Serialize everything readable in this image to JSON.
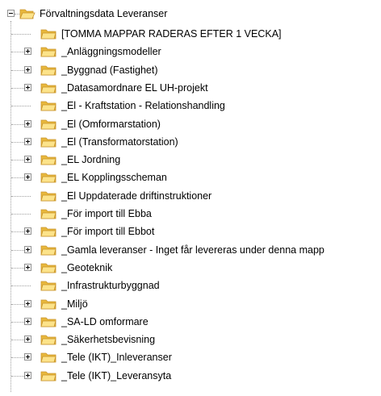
{
  "tree": {
    "root": {
      "label": "Förvaltningsdata Leveranser",
      "icon": "folder-open-icon",
      "expanded": true
    },
    "children": [
      {
        "label": "[TOMMA MAPPAR RADERAS EFTER 1 VECKA]",
        "expandable": false
      },
      {
        "label": "_Anläggningsmodeller",
        "expandable": true
      },
      {
        "label": "_Byggnad (Fastighet)",
        "expandable": true
      },
      {
        "label": "_Datasamordnare EL UH-projekt",
        "expandable": true
      },
      {
        "label": "_El - Kraftstation - Relationshandling",
        "expandable": false
      },
      {
        "label": "_El (Omformarstation)",
        "expandable": true
      },
      {
        "label": "_El (Transformatorstation)",
        "expandable": true
      },
      {
        "label": "_EL Jordning",
        "expandable": true
      },
      {
        "label": "_EL Kopplingsscheman",
        "expandable": true
      },
      {
        "label": "_El Uppdaterade driftinstruktioner",
        "expandable": false
      },
      {
        "label": "_För import till Ebba",
        "expandable": false
      },
      {
        "label": "_För import till Ebbot",
        "expandable": true
      },
      {
        "label": "_Gamla leveranser - Inget får levereras under denna mapp",
        "expandable": true
      },
      {
        "label": "_Geoteknik",
        "expandable": true
      },
      {
        "label": "_Infrastrukturbyggnad",
        "expandable": false
      },
      {
        "label": "_Miljö",
        "expandable": true
      },
      {
        "label": "_SA-LD omformare",
        "expandable": true
      },
      {
        "label": "_Säkerhetsbevisning",
        "expandable": true
      },
      {
        "label": "_Tele (IKT)_Inleveranser",
        "expandable": true
      },
      {
        "label": "_Tele (IKT)_Leveransyta",
        "expandable": true
      }
    ]
  },
  "colors": {
    "folder_light": "#fce38a",
    "folder_dark": "#e8b83c",
    "folder_edge": "#c8932a",
    "tree_line": "#a0a0a0",
    "expander_border": "#919191"
  }
}
